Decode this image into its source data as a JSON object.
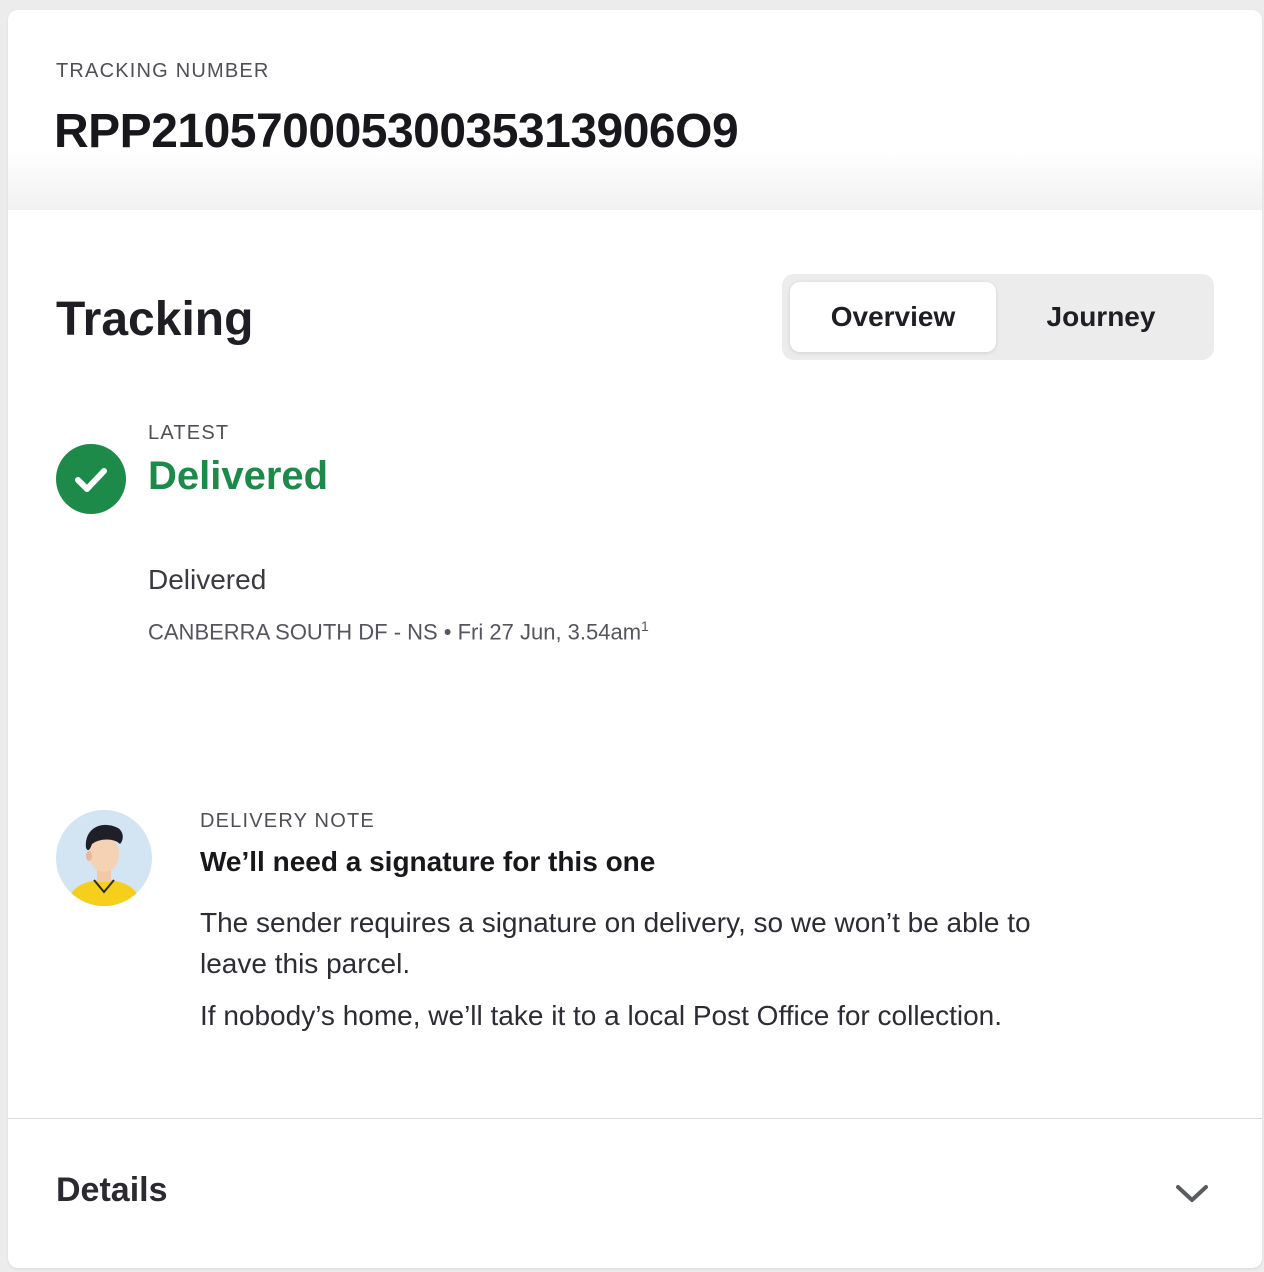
{
  "tracking_number": {
    "label": "TRACKING NUMBER",
    "value": "RPP21057000530035313906O9"
  },
  "tracking": {
    "title": "Tracking",
    "tabs": [
      {
        "label": "Overview",
        "active": true
      },
      {
        "label": "Journey",
        "active": false
      }
    ],
    "latest_label": "LATEST",
    "latest_status": "Delivered",
    "status_color": "#1e8a4a",
    "status_icon": "check-icon",
    "event": {
      "description": "Delivered",
      "location_time": "CANBERRA SOUTH DF - NS • Fri 27 Jun, 3.54am",
      "footnote": "1"
    }
  },
  "delivery_note": {
    "label": "DELIVERY NOTE",
    "heading": "We’ll need a signature for this one",
    "body_1": "The sender requires a signature on delivery, so we won’t be able to leave this parcel.",
    "body_2": "If nobody’s home, we’ll take it to a local Post Office for collection.",
    "avatar_icon": "courier-avatar"
  },
  "details": {
    "label": "Details",
    "icon": "chevron-down-icon"
  }
}
